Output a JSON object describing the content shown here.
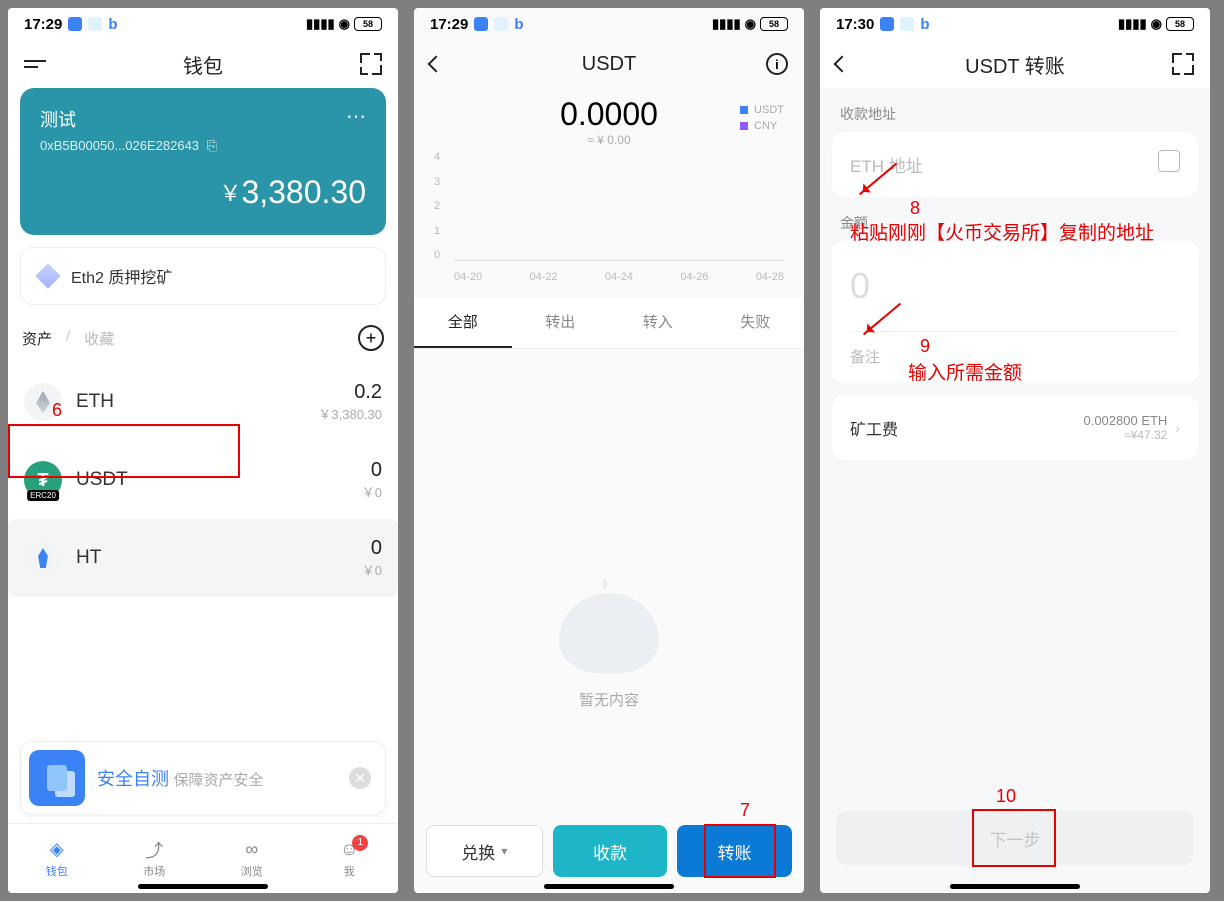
{
  "status_bar": {
    "time_a": "17:29",
    "time_b": "17:30",
    "battery": "58"
  },
  "screen1": {
    "title": "钱包",
    "wallet": {
      "name": "测试",
      "address": "0xB5B00050...026E282643",
      "balance_currency": "￥",
      "balance": "3,380.30"
    },
    "stake_label": "Eth2 质押挖矿",
    "tabs": {
      "assets": "资产",
      "fav": "收藏",
      "sep": "/"
    },
    "assets": [
      {
        "symbol": "ETH",
        "amount": "0.2",
        "value": "￥3,380.30"
      },
      {
        "symbol": "USDT",
        "amount": "0",
        "value": "￥0",
        "badge": "ERC20"
      },
      {
        "symbol": "HT",
        "amount": "0",
        "value": "￥0"
      }
    ],
    "promo": {
      "title": "安全自测",
      "sub": "保障资产安全"
    },
    "nav": {
      "wallet": "钱包",
      "market": "市场",
      "browse": "浏览",
      "me": "我",
      "badge": "1"
    }
  },
  "screen2": {
    "title": "USDT",
    "balance": "0.0000",
    "balance_sub": "≈ ¥ 0.00",
    "legend": [
      {
        "label": "USDT",
        "color": "#3b82f6"
      },
      {
        "label": "CNY",
        "color": "#8b5cf6"
      }
    ],
    "tx_tabs": {
      "all": "全部",
      "out": "转出",
      "in": "转入",
      "fail": "失败"
    },
    "empty": "暂无内容",
    "actions": {
      "exchange": "兑换",
      "receive": "收款",
      "transfer": "转账"
    }
  },
  "screen3": {
    "title": "USDT 转账",
    "addr_label": "收款地址",
    "addr_placeholder": "ETH 地址",
    "amount_label": "金额",
    "amount_placeholder": "0",
    "memo_label": "备注",
    "fee_label": "矿工费",
    "fee_amount": "0.002800 ETH",
    "fee_value": "≈¥47.32",
    "next": "下一步"
  },
  "chart_data": {
    "type": "line",
    "x": [
      "04-20",
      "04-22",
      "04-24",
      "04-26",
      "04-28"
    ],
    "y_ticks": [
      0,
      1,
      2,
      3,
      4
    ],
    "series": [
      {
        "name": "USDT",
        "values": [
          0,
          0,
          0,
          0,
          0
        ]
      },
      {
        "name": "CNY",
        "values": [
          0,
          0,
          0,
          0,
          0
        ]
      }
    ],
    "ylim": [
      0,
      4
    ]
  },
  "annotations": {
    "n6": "6",
    "n7": "7",
    "n8": "8",
    "t8": "粘贴刚刚【火币交易所】复制的地址",
    "n9": "9",
    "t9": "输入所需金额",
    "n10": "10"
  }
}
